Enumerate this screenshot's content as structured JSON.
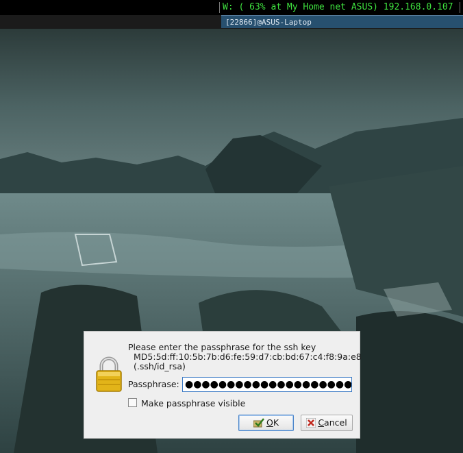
{
  "statusbar": {
    "wifi": "W: ( 63% at My Home net ASUS) 192.168.0.107"
  },
  "window": {
    "title": "[22866]@ASUS-Laptop"
  },
  "dialog": {
    "prompt": "Please enter the passphrase for the ssh key",
    "fingerprint": "MD5:5d:ff:10:5b:7b:d6:fe:59:d7:cb:bd:67:c4:f8:9a:e8",
    "key_path": "(.ssh/id_rsa)",
    "passphrase_label": "Passphrase:",
    "passphrase_value": "●●●●●●●●●●●●●●●●●●●●●",
    "show_passphrase_label": "Make passphrase visible",
    "show_passphrase_checked": false,
    "ok_first": "O",
    "ok_rest": "K",
    "cancel_first": "C",
    "cancel_rest": "ancel"
  },
  "icons": [
    "lock-icon",
    "checkmark-icon",
    "cancel-x-icon"
  ],
  "colors": {
    "status_green": "#3fe23f",
    "title_bar": "#27506f",
    "input_focus": "#3a79c4"
  }
}
